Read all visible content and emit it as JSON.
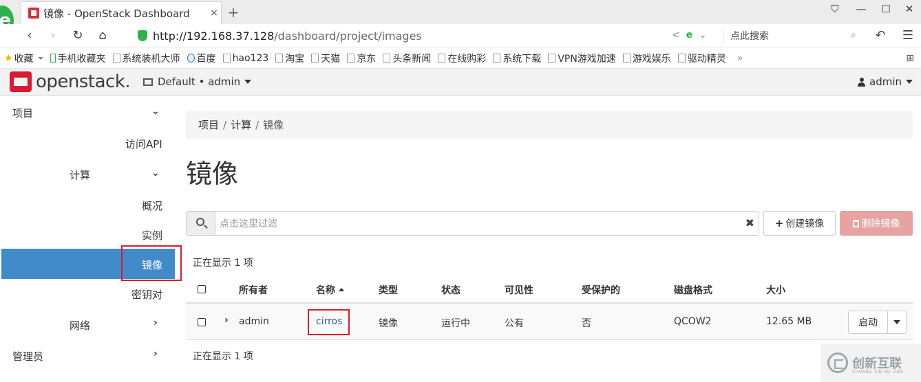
{
  "browser": {
    "tab_title": "镜像 - OpenStack Dashboard",
    "tab_close": "×",
    "new_tab": "+",
    "logo_char": "e",
    "url_host": "http://192.168.37.128",
    "url_path": "/dashboard/project/images",
    "search_placeholder": "点此搜索",
    "bookmarks": [
      {
        "label": "收藏",
        "icon": "star-icon"
      },
      {
        "label": "手机收藏夹",
        "icon": "phone-icon"
      },
      {
        "label": "系统装机大师",
        "icon": "page-icon"
      },
      {
        "label": "百度",
        "icon": "baidu-icon"
      },
      {
        "label": "hao123",
        "icon": "page-icon"
      },
      {
        "label": "淘宝",
        "icon": "page-icon"
      },
      {
        "label": "天猫",
        "icon": "page-icon"
      },
      {
        "label": "京东",
        "icon": "page-icon"
      },
      {
        "label": "头条新闻",
        "icon": "page-icon"
      },
      {
        "label": "在线购彩",
        "icon": "page-icon"
      },
      {
        "label": "系统下载",
        "icon": "page-icon"
      },
      {
        "label": "VPN游戏加速",
        "icon": "page-icon"
      },
      {
        "label": "游戏娱乐",
        "icon": "page-icon"
      },
      {
        "label": "驱动精灵",
        "icon": "page-icon"
      }
    ],
    "bookmarks_more": "»"
  },
  "header": {
    "logo_text": "openstack",
    "logo_tm": ".",
    "project_selector": "Default • admin",
    "user_menu": "admin"
  },
  "sidebar": {
    "project": "项目",
    "access_api": "访问API",
    "compute": "计算",
    "overview": "概况",
    "instances": "实例",
    "images": "镜像",
    "key_pairs": "密钥对",
    "network": "网络",
    "admin": "管理员"
  },
  "breadcrumb": {
    "items": [
      "项目",
      "计算",
      "镜像"
    ],
    "separator": "/"
  },
  "page_title": "镜像",
  "filter": {
    "placeholder": "点击这里过滤",
    "clear": "✖"
  },
  "buttons": {
    "create_image": "创建镜像",
    "delete_images": "删除镜像"
  },
  "count_text": "正在显示 1 项",
  "table": {
    "columns": [
      "所有者",
      "名称",
      "类型",
      "状态",
      "可见性",
      "受保护的",
      "磁盘格式",
      "大小"
    ],
    "rows": [
      {
        "owner": "admin",
        "name": "cirros",
        "type": "镜像",
        "status": "运行中",
        "visibility": "公有",
        "protected": "否",
        "disk_format": "QCOW2",
        "size": "12.65 MB",
        "action": "启动"
      }
    ]
  },
  "watermark": {
    "text": "创新互联",
    "sub": "CHUANG XIN HU LIAN"
  },
  "colors": {
    "accent": "#428bca",
    "danger_disabled": "#e8a3a1",
    "highlight_box": "#d81e27",
    "logo_red": "#da1a32"
  }
}
